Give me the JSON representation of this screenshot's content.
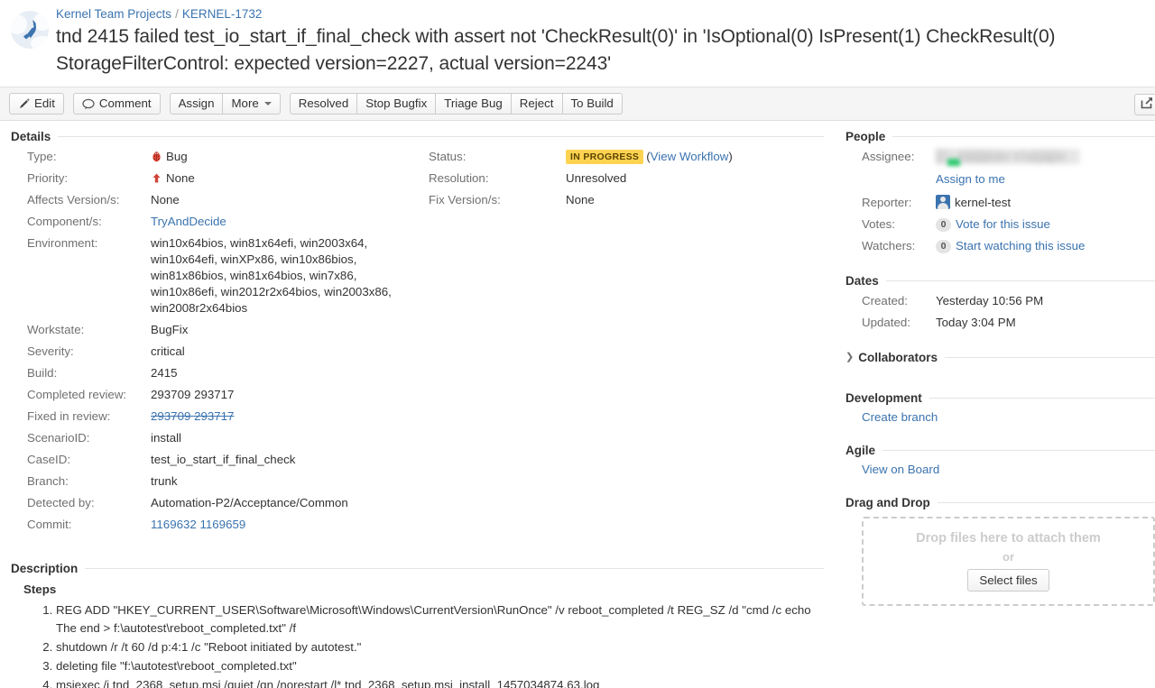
{
  "header": {
    "avatar_icon": "rocket-icon",
    "breadcrumb": {
      "project": "Kernel Team Projects",
      "separator": "/",
      "issue_key": "KERNEL-1732"
    },
    "title": "tnd 2415 failed test_io_start_if_final_check with assert not 'CheckResult(0)' in 'IsOptional(0) IsPresent(1) CheckResult(0) StorageFilterControl: expected version=2227, actual version=2243'"
  },
  "toolbar": {
    "edit_label": "Edit",
    "comment_label": "Comment",
    "assign_label": "Assign",
    "more_label": "More",
    "workflow_buttons": [
      "Resolved",
      "Stop Bugfix",
      "Triage Bug",
      "Reject",
      "To Build"
    ],
    "share_icon": "share-icon"
  },
  "details": {
    "section_title": "Details",
    "left": [
      {
        "label": "Type:",
        "value": "Bug",
        "icon": "bug-icon"
      },
      {
        "label": "Priority:",
        "value": "None",
        "icon": "priority-up-arrow-icon"
      },
      {
        "label": "Affects Version/s:",
        "value": "None"
      },
      {
        "label": "Component/s:",
        "value": "TryAndDecide",
        "link": true
      },
      {
        "label": "Environment:",
        "value": "win10x64bios, win81x64efi, win2003x64, win10x64efi, winXPx86, win10x86bios, win81x86bios, win81x64bios, win7x86, win10x86efi, win2012r2x64bios, win2003x86, win2008r2x64bios"
      },
      {
        "label": "Workstate:",
        "value": "BugFix"
      },
      {
        "label": "Severity:",
        "value": "critical"
      },
      {
        "label": "Build:",
        "value": "2415"
      },
      {
        "label": "Completed review:",
        "value": "293709 293717"
      },
      {
        "label": "Fixed in review:",
        "value": "293709 293717",
        "link": true,
        "strike": true
      },
      {
        "label": "ScenarioID:",
        "value": "install"
      },
      {
        "label": "CaseID:",
        "value": "test_io_start_if_final_check"
      },
      {
        "label": "Branch:",
        "value": "trunk"
      },
      {
        "label": "Detected by:",
        "value": "Automation-P2/Acceptance/Common"
      },
      {
        "label": "Commit:",
        "value": "1169632 1169659",
        "link": true
      }
    ],
    "right": {
      "status_label": "Status:",
      "status_value": "IN PROGRESS",
      "status_color": "#ffd351",
      "view_workflow": "View Workflow",
      "resolution_label": "Resolution:",
      "resolution_value": "Unresolved",
      "fix_version_label": "Fix Version/s:",
      "fix_version_value": "None"
    }
  },
  "description": {
    "section_title": "Description",
    "steps_title": "Steps",
    "steps": [
      "REG ADD \"HKEY_CURRENT_USER\\Software\\Microsoft\\Windows\\CurrentVersion\\RunOnce\" /v reboot_completed /t REG_SZ /d \"cmd /c echo The end > f:\\autotest\\reboot_completed.txt\" /f",
      "shutdown /r /t 60 /d p:4:1 /c \"Reboot initiated by autotest.\"",
      "deleting file \"f:\\autotest\\reboot_completed.txt\"",
      "msiexec /i tnd_2368_setup.msi /quiet /qn /norestart /l* tnd_2368_setup.msi_install_1457034874.63.log"
    ]
  },
  "sidebar": {
    "people": {
      "title": "People",
      "assignee_label": "Assignee:",
      "assignee_value": "Alexander Khalyapin",
      "assign_to_me": "Assign to me",
      "reporter_label": "Reporter:",
      "reporter_value": "kernel-test",
      "votes_label": "Votes:",
      "votes_count": "0",
      "votes_link": "Vote for this issue",
      "watchers_label": "Watchers:",
      "watchers_count": "0",
      "watchers_link": "Start watching this issue"
    },
    "dates": {
      "title": "Dates",
      "created_label": "Created:",
      "created_value": "Yesterday 10:56 PM",
      "updated_label": "Updated:",
      "updated_value": "Today 3:04 PM"
    },
    "collaborators": {
      "title": "Collaborators",
      "collapsed": true
    },
    "development": {
      "title": "Development",
      "create_branch": "Create branch"
    },
    "agile": {
      "title": "Agile",
      "view_on_board": "View on Board"
    },
    "drag_and_drop": {
      "title": "Drag and Drop",
      "drop_text": "Drop files here to attach them",
      "or_text": "or",
      "select_files": "Select files"
    }
  }
}
